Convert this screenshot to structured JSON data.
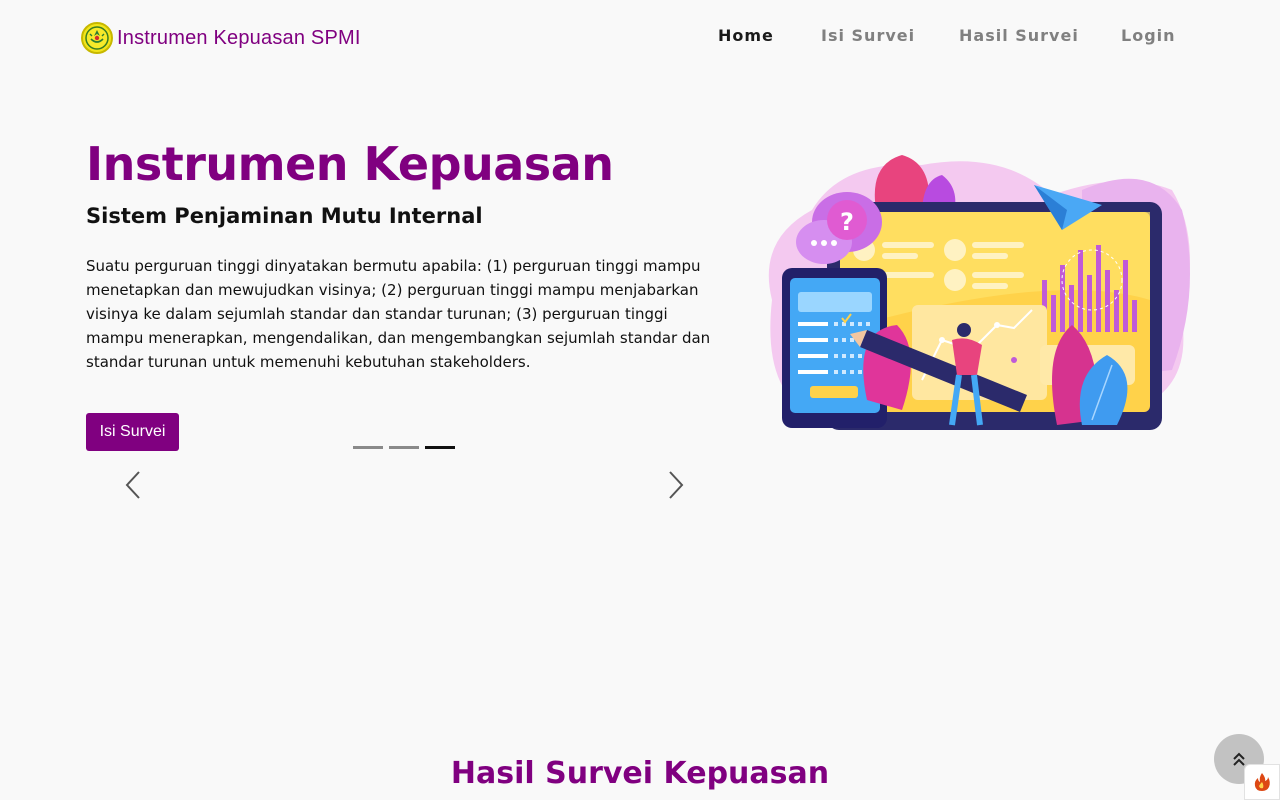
{
  "brand": {
    "title": "Instrumen Kepuasan SPMI",
    "logo_icon": "university-seal-icon"
  },
  "nav": {
    "items": [
      {
        "label": "Home",
        "active": true
      },
      {
        "label": "Isi Survei",
        "active": false
      },
      {
        "label": "Hasil Survei",
        "active": false
      },
      {
        "label": "Login",
        "active": false
      }
    ]
  },
  "hero": {
    "title": "Instrumen Kepuasan",
    "subtitle": "Sistem Penjaminan Mutu Internal",
    "description": "Suatu perguruan tinggi dinyatakan bermutu apabila: (1) perguruan tinggi mampu menetapkan dan mewujudkan visinya; (2) perguruan tinggi mampu menjabarkan visinya ke dalam sejumlah standar dan standar turunan; (3) perguruan tinggi mampu menerapkan, mengendalikan, dan mengembangkan sejumlah standar dan standar turunan untuk memenuhi kebutuhan stakeholders.",
    "cta_label": "Isi Survei",
    "illustration_icon": "survey-illustration",
    "carousel": {
      "slide_count": 3,
      "active_index": 2,
      "prev_icon": "chevron-left-icon",
      "next_icon": "chevron-right-icon"
    }
  },
  "section": {
    "title": "Hasil Survei Kepuasan"
  },
  "floating": {
    "back_to_top_icon": "double-chevron-up-icon",
    "debug_icon": "flame-icon"
  },
  "colors": {
    "accent": "#800080",
    "background": "#f9f9f9",
    "nav_inactive": "#808080"
  }
}
